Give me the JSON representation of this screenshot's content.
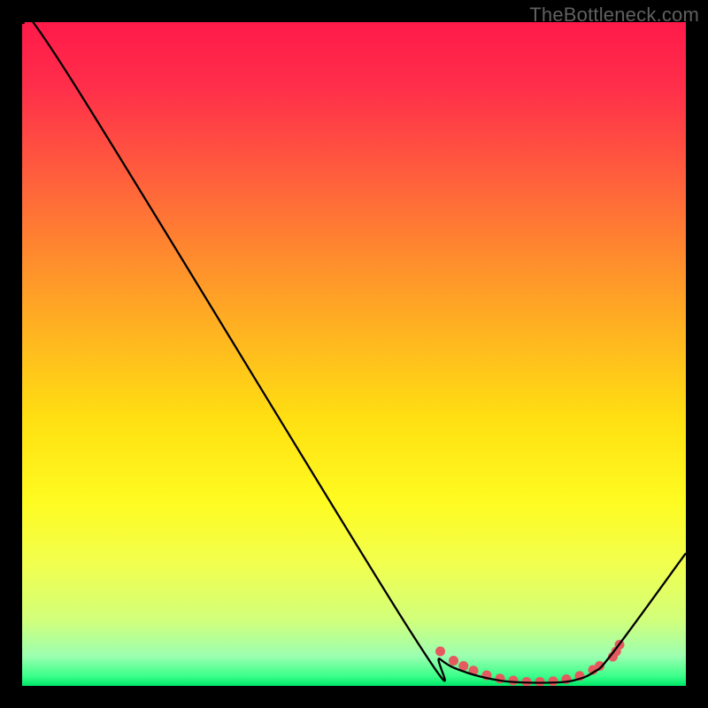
{
  "watermark": "TheBottleneck.com",
  "gradient_stops": [
    {
      "offset": 0.0,
      "color": "#ff1a4a"
    },
    {
      "offset": 0.1,
      "color": "#ff2f4a"
    },
    {
      "offset": 0.22,
      "color": "#ff5a3e"
    },
    {
      "offset": 0.35,
      "color": "#ff8a2e"
    },
    {
      "offset": 0.48,
      "color": "#ffb81f"
    },
    {
      "offset": 0.6,
      "color": "#ffe012"
    },
    {
      "offset": 0.72,
      "color": "#fffb20"
    },
    {
      "offset": 0.82,
      "color": "#f0ff50"
    },
    {
      "offset": 0.9,
      "color": "#d2ff7a"
    },
    {
      "offset": 0.955,
      "color": "#9cffb0"
    },
    {
      "offset": 0.985,
      "color": "#3cff8a"
    },
    {
      "offset": 1.0,
      "color": "#00e868"
    }
  ],
  "chart_data": {
    "type": "line",
    "title": "",
    "xlabel": "",
    "ylabel": "",
    "xlim": [
      0,
      100
    ],
    "ylim": [
      0,
      100
    ],
    "series": [
      {
        "name": "curve",
        "x": [
          0,
          7,
          58,
          63,
          67,
          72,
          76,
          80,
          83,
          86,
          89,
          100
        ],
        "y": [
          100,
          92,
          9,
          4,
          2,
          0.8,
          0.5,
          0.5,
          0.8,
          2,
          5,
          20
        ]
      }
    ],
    "markers": {
      "name": "dots",
      "x": [
        63,
        65,
        66.5,
        68,
        70,
        72,
        74,
        76,
        78,
        80,
        82,
        84,
        86,
        87,
        89,
        89.5,
        90
      ],
      "y": [
        5.2,
        3.8,
        3.0,
        2.3,
        1.6,
        1.1,
        0.8,
        0.6,
        0.6,
        0.7,
        1.0,
        1.5,
        2.4,
        3.0,
        4.4,
        5.2,
        6.2
      ]
    }
  },
  "curve_style": {
    "stroke": "#000000",
    "width": 2.3
  },
  "marker_style": {
    "fill": "#e55a5f",
    "radius": 5.5
  }
}
